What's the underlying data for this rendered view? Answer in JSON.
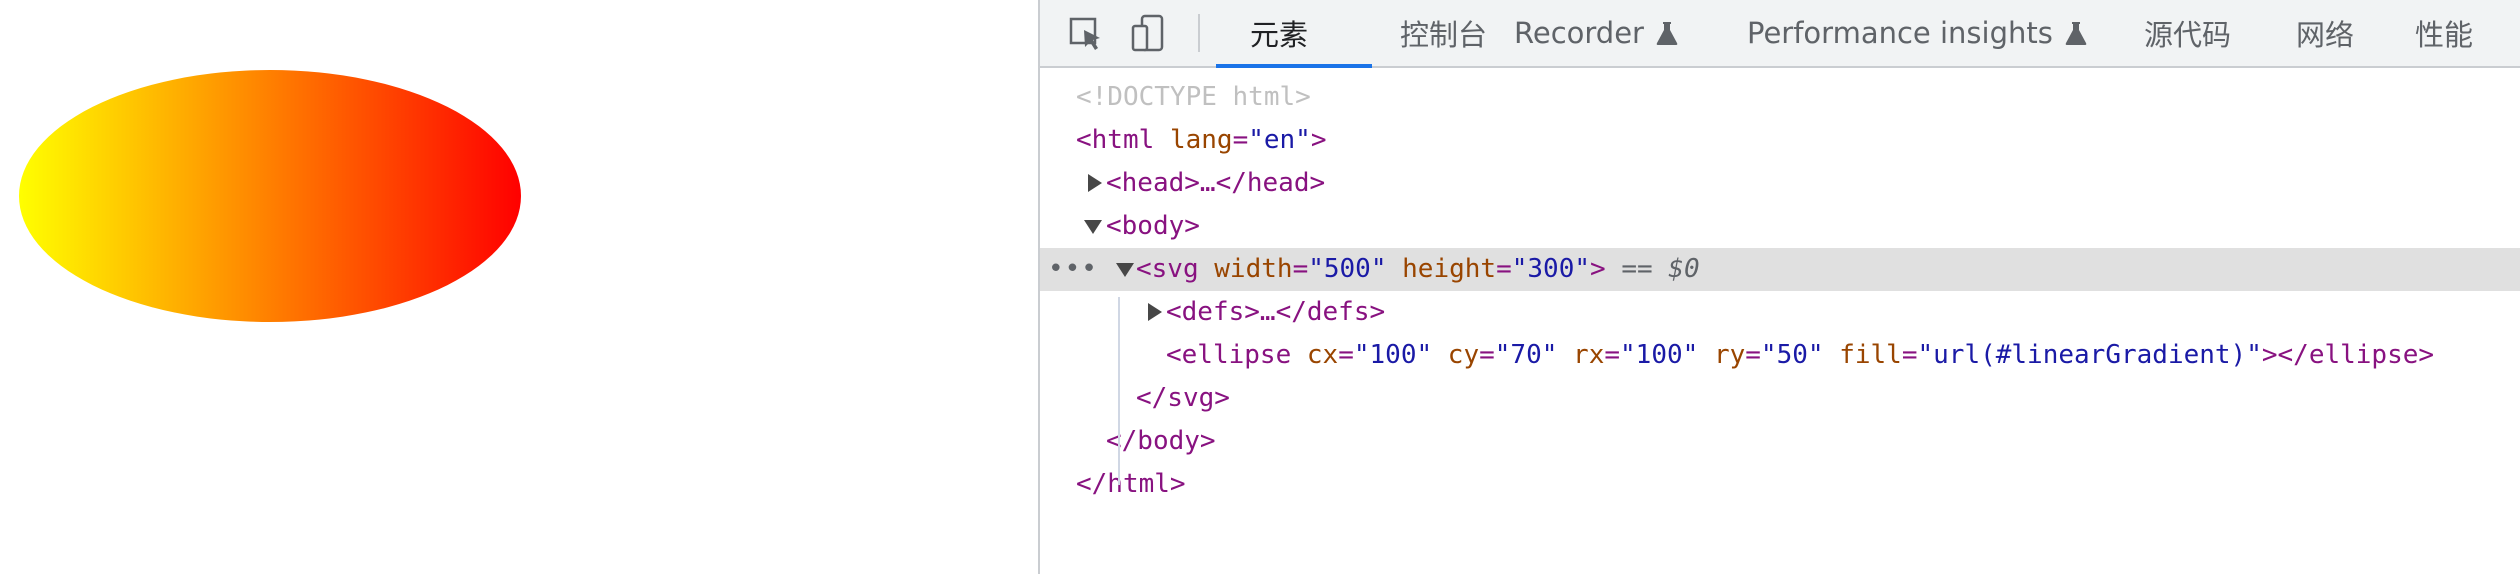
{
  "toolbar": {
    "tabs": [
      {
        "label": "元素",
        "active": true
      },
      {
        "label": "控制台"
      },
      {
        "label": "Recorder",
        "experimental": true
      },
      {
        "label": "Performance insights",
        "experimental": true
      },
      {
        "label": "源代码"
      },
      {
        "label": "网络"
      },
      {
        "label": "性能"
      }
    ],
    "icons": [
      "select-element-icon",
      "device-toolbar-icon",
      "flask-icon"
    ]
  },
  "page_preview": {
    "shape": "ellipse",
    "gradient": {
      "from": "#ffff00",
      "to": "#ff0000",
      "direction": "left-to-right"
    }
  },
  "dom": {
    "doctype": "<!DOCTYPE html>",
    "html": {
      "open": "<html",
      "attr": "lang",
      "value": "\"en\"",
      "close": ">",
      "eq": "="
    },
    "head": "<head>…</head>",
    "body_open": "<body>",
    "svg": {
      "open": "<svg",
      "a1": "width",
      "v1": "\"500\"",
      "a2": "height",
      "v2": "\"300\"",
      "close": ">",
      "selected_marker": "== $0",
      "eq": "="
    },
    "defs": "<defs>…</defs>",
    "ellipse": {
      "open": "<ellipse",
      "a1": "cx",
      "v1": "\"100\"",
      "a2": "cy",
      "v2": "\"70\"",
      "a3": "rx",
      "v3": "\"100\"",
      "a4": "ry",
      "v4": "\"50\"",
      "a5": "fill",
      "v5": "\"url(#linearGradient)\"",
      "close": "></ellipse>",
      "eq": "="
    },
    "svg_close": "</svg>",
    "body_close": "</body>",
    "html_close": "</html>",
    "row_menu": "•••"
  },
  "colors": {
    "tag": "#881280",
    "attr_name": "#994500",
    "attr_value": "#1a1aa6",
    "selected_row": "#e0e0e0",
    "active_tab_underline": "#1a73e8"
  }
}
